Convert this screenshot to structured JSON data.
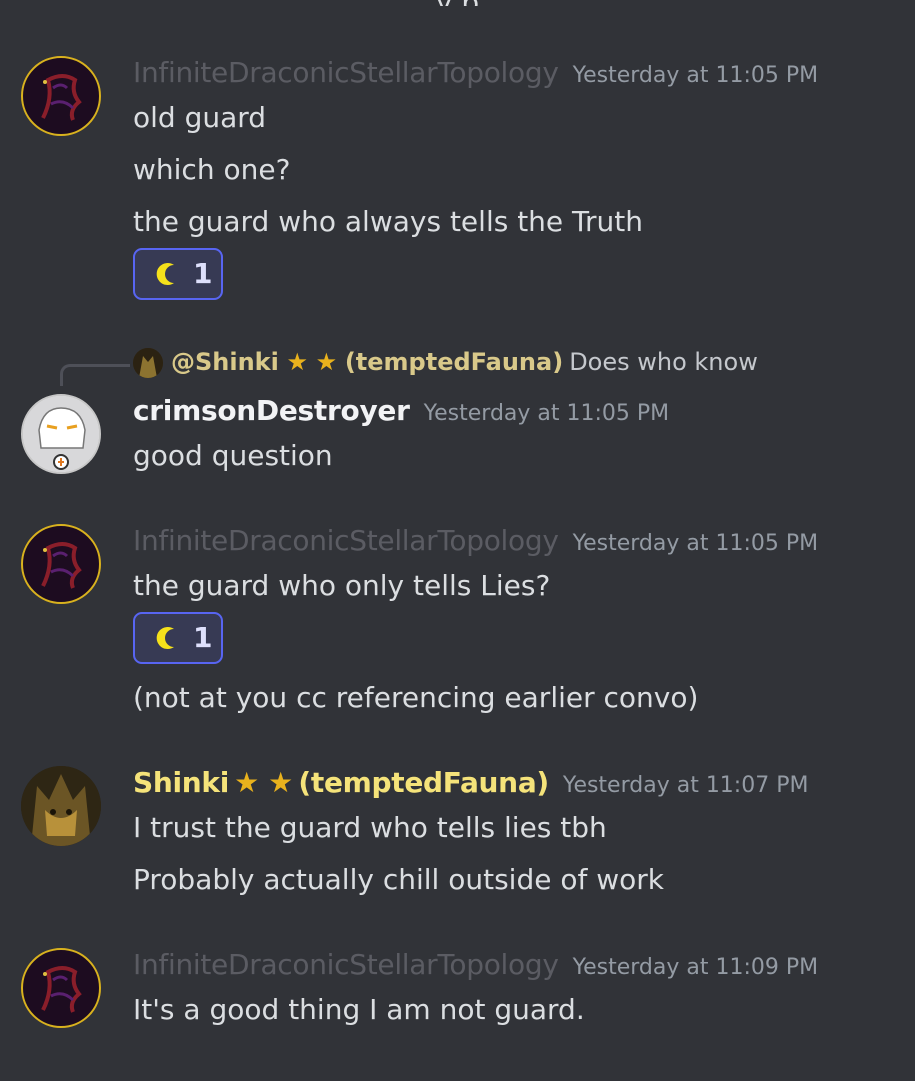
{
  "top_fragment": "y p",
  "messages": [
    {
      "username": "InfiniteDraconicStellarTopology",
      "timestamp": "Yesterday at 11:05 PM",
      "lines": [
        "old guard",
        "which one?",
        "the guard who always tells the Truth"
      ],
      "reaction": {
        "icon": "crescent-moon-icon",
        "count": "1"
      }
    },
    {
      "reply": {
        "mention": "@Shinki",
        "stars": "★ ★",
        "handle": "(temptedFauna)",
        "text": "Does who know"
      },
      "username": "crimsonDestroyer",
      "timestamp": "Yesterday at 11:05 PM",
      "lines": [
        "good question"
      ]
    },
    {
      "username": "InfiniteDraconicStellarTopology",
      "timestamp": "Yesterday at 11:05 PM",
      "lines": [
        "the guard who only tells Lies?",
        "(not at you cc referencing earlier convo)"
      ],
      "reaction": {
        "icon": "crescent-moon-icon",
        "count": "1"
      }
    },
    {
      "username": "Shinki",
      "stars": "★ ★",
      "handle": "(temptedFauna)",
      "timestamp": "Yesterday at 11:07 PM",
      "lines": [
        "I trust the guard who tells lies tbh",
        "Probably actually chill outside of work"
      ]
    },
    {
      "username": "InfiniteDraconicStellarTopology",
      "timestamp": "Yesterday at 11:09 PM",
      "lines": [
        "It's a good thing I am not guard."
      ]
    }
  ],
  "colors": {
    "background": "#313338",
    "reaction_border": "#5865f2",
    "moon": "#f5e11b",
    "shinki_name": "#f5e37a"
  }
}
